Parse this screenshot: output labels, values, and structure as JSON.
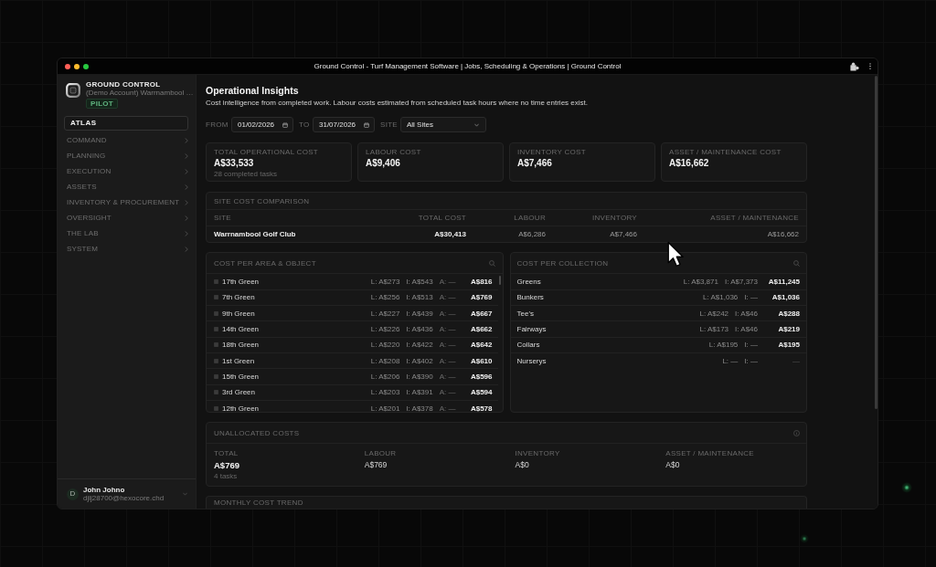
{
  "window": {
    "title": "Ground Control - Turf Management Software | Jobs, Scheduling & Operations | Ground Control"
  },
  "sidebar": {
    "brand": "GROUND CONTROL",
    "account": "(Demo Account) Warrnambool …",
    "badge": "PILOT",
    "workspace": "ATLAS",
    "items": [
      "COMMAND",
      "PLANNING",
      "EXECUTION",
      "ASSETS",
      "INVENTORY & PROCUREMENT",
      "OVERSIGHT",
      "THE LAB",
      "SYSTEM"
    ],
    "user": {
      "initial": "D",
      "name": "John Johno",
      "email": "djlj28700@hexocore.chd"
    }
  },
  "page": {
    "title": "Operational Insights",
    "subtitle": "Cost intelligence from completed work. Labour costs estimated from scheduled task hours where no time entries exist."
  },
  "filters": [
    {
      "kind": "date",
      "label": "FROM",
      "value": "01/02/2026"
    },
    {
      "kind": "date",
      "label": "TO",
      "value": "31/07/2026"
    },
    {
      "kind": "select",
      "label": "SITE",
      "value": "All Sites"
    }
  ],
  "stats": [
    {
      "label": "TOTAL OPERATIONAL COST",
      "value": "A$33,533",
      "note": "28 completed tasks"
    },
    {
      "label": "LABOUR COST",
      "value": "A$9,406"
    },
    {
      "label": "INVENTORY COST",
      "value": "A$7,466"
    },
    {
      "label": "ASSET / MAINTENANCE COST",
      "value": "A$16,662"
    }
  ],
  "site_comparison": {
    "title": "SITE COST COMPARISON",
    "columns": [
      "SITE",
      "TOTAL COST",
      "LABOUR",
      "INVENTORY",
      "ASSET / MAINTENANCE"
    ],
    "rows": [
      [
        "Warrnambool Golf Club",
        "A$30,413",
        "A$6,286",
        "A$7,466",
        "A$16,662"
      ]
    ]
  },
  "area_costs": {
    "title": "COST PER AREA & OBJECT",
    "rows": [
      {
        "name": "17th Green",
        "labour": "L: A$273",
        "inventory": "I: A$543",
        "asset": "A: —",
        "total": "A$816"
      },
      {
        "name": "7th Green",
        "labour": "L: A$256",
        "inventory": "I: A$513",
        "asset": "A: —",
        "total": "A$769"
      },
      {
        "name": "9th Green",
        "labour": "L: A$227",
        "inventory": "I: A$439",
        "asset": "A: —",
        "total": "A$667"
      },
      {
        "name": "14th Green",
        "labour": "L: A$226",
        "inventory": "I: A$436",
        "asset": "A: —",
        "total": "A$662"
      },
      {
        "name": "18th Green",
        "labour": "L: A$220",
        "inventory": "I: A$422",
        "asset": "A: —",
        "total": "A$642"
      },
      {
        "name": "1st Green",
        "labour": "L: A$208",
        "inventory": "I: A$402",
        "asset": "A: —",
        "total": "A$610"
      },
      {
        "name": "15th Green",
        "labour": "L: A$206",
        "inventory": "I: A$390",
        "asset": "A: —",
        "total": "A$596"
      },
      {
        "name": "3rd Green",
        "labour": "L: A$203",
        "inventory": "I: A$391",
        "asset": "A: —",
        "total": "A$594"
      },
      {
        "name": "12th Green",
        "labour": "L: A$201",
        "inventory": "I: A$378",
        "asset": "A: —",
        "total": "A$578"
      }
    ]
  },
  "collection_costs": {
    "title": "COST PER COLLECTION",
    "rows": [
      {
        "name": "Greens",
        "labour": "L: A$3,871",
        "inventory": "I: A$7,373",
        "total": "A$11,245",
        "muted": false
      },
      {
        "name": "Bunkers",
        "labour": "L: A$1,036",
        "inventory": "I: —",
        "total": "A$1,036",
        "muted": false
      },
      {
        "name": "Tee's",
        "labour": "L: A$242",
        "inventory": "I: A$46",
        "total": "A$288",
        "muted": false
      },
      {
        "name": "Fairways",
        "labour": "L: A$173",
        "inventory": "I: A$46",
        "total": "A$219",
        "muted": false
      },
      {
        "name": "Collars",
        "labour": "L: A$195",
        "inventory": "I: —",
        "total": "A$195",
        "muted": false
      },
      {
        "name": "Nurserys",
        "labour": "L: —",
        "inventory": "I: —",
        "total": "—",
        "muted": true
      }
    ]
  },
  "unallocated": {
    "title": "UNALLOCATED COSTS",
    "metrics": [
      {
        "kind": "total",
        "label": "TOTAL",
        "value": "A$769",
        "note": "4 tasks"
      },
      {
        "kind": "part",
        "label": "LABOUR",
        "value": "A$769"
      },
      {
        "kind": "part",
        "label": "INVENTORY",
        "value": "A$0"
      },
      {
        "kind": "part",
        "label": "ASSET / MAINTENANCE",
        "value": "A$0"
      }
    ]
  },
  "monthly_trend": {
    "title": "MONTHLY COST TREND"
  }
}
